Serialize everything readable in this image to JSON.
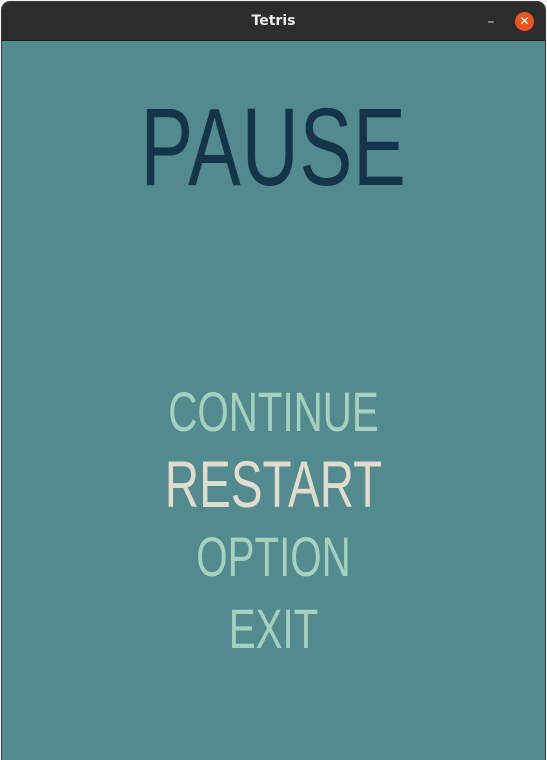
{
  "window": {
    "title": "Tetris",
    "minimize_label": "–",
    "close_label": "✕"
  },
  "screen": {
    "heading": "PAUSE",
    "menu": [
      {
        "label": "CONTINUE",
        "selected": false
      },
      {
        "label": "RESTART",
        "selected": true
      },
      {
        "label": "OPTION",
        "selected": false
      },
      {
        "label": "EXIT",
        "selected": false
      }
    ]
  },
  "colors": {
    "background": "#528b8f",
    "heading": "#163447",
    "menu_item": "#a6d1bd",
    "menu_item_selected": "#e2dccc",
    "titlebar": "#2c2c2c",
    "close_button": "#e95420"
  }
}
